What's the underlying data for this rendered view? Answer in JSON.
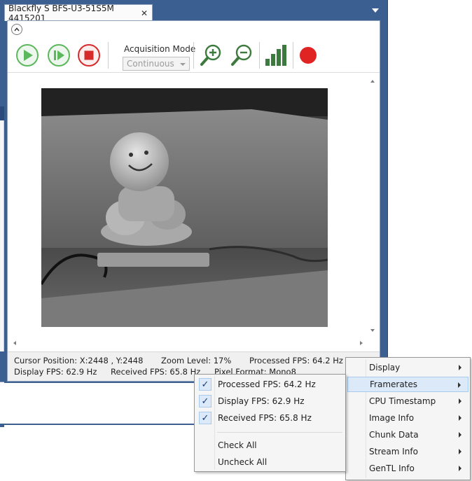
{
  "window": {
    "tab_title": "Blackfly S BFS-U3-51S5M 4415201",
    "tab_close": "✕"
  },
  "toolbar": {
    "acquisition_mode_label": "Acquisition Mode",
    "acquisition_mode_value": "Continuous"
  },
  "status": {
    "cursor_position": "Cursor Position: X:2448 , Y:2448",
    "zoom_level": "Zoom Level: 17%",
    "processed_fps": "Processed FPS: 64.2 Hz",
    "display_fps": "Display FPS: 62.9 Hz",
    "received_fps": "Received FPS: 65.8 Hz",
    "pixel_format": "Pixel Format: Mono8"
  },
  "context_menu": {
    "items": [
      {
        "label": "Display"
      },
      {
        "label": "Framerates"
      },
      {
        "label": "CPU Timestamp"
      },
      {
        "label": "Image Info"
      },
      {
        "label": "Chunk Data"
      },
      {
        "label": "Stream Info"
      },
      {
        "label": "GenTL Info"
      }
    ]
  },
  "framerates_submenu": {
    "items": [
      {
        "label": "Processed FPS: 64.2 Hz",
        "checked": true
      },
      {
        "label": "Display FPS: 62.9 Hz",
        "checked": true
      },
      {
        "label": "Received FPS: 65.8 Hz",
        "checked": true
      }
    ],
    "check_all": "Check All",
    "uncheck_all": "Uncheck All"
  },
  "colors": {
    "play_green": "#5cb85c",
    "stop_red": "#d62b2b",
    "record_red": "#e02424",
    "histogram_green": "#3d7a3d",
    "window_blue": "#3c5f91"
  }
}
